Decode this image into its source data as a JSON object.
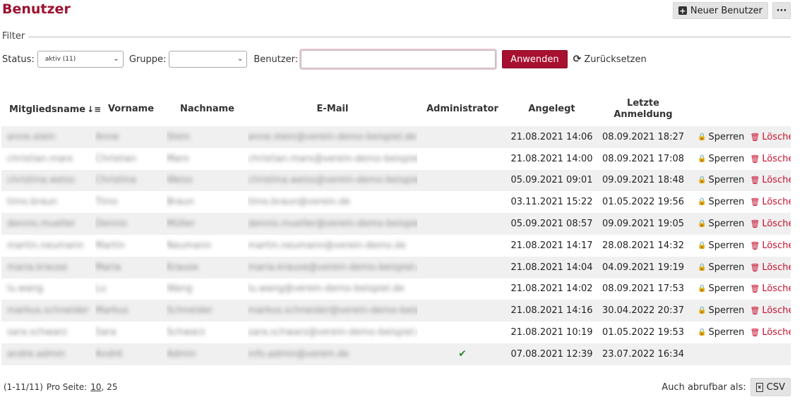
{
  "header": {
    "title": "Benutzer",
    "new_user_label": "Neuer Benutzer",
    "more_label": "···"
  },
  "filter": {
    "legend": "Filter",
    "status_label": "Status:",
    "status_value": "aktiv (11)",
    "group_label": "Gruppe:",
    "group_value": "",
    "user_label": "Benutzer:",
    "user_value": "",
    "apply_label": "Anwenden",
    "reset_label": "Zurücksetzen"
  },
  "table": {
    "columns": {
      "username": "Mitgliedsname",
      "firstname": "Vorname",
      "lastname": "Nachname",
      "email": "E-Mail",
      "admin": "Administrator",
      "created": "Angelegt",
      "last_login_1": "Letzte",
      "last_login_2": "Anmeldung"
    },
    "lock_label": "Sperren",
    "delete_label": "Löschen",
    "rows": [
      {
        "username": "anne.stein",
        "first": "Anne",
        "last": "Stein",
        "email": "anne.stein@verein-demo-beispiel.de",
        "admin": "",
        "created": "21.08.2021 14:06",
        "last_login": "08.09.2021 18:27"
      },
      {
        "username": "christian.marx",
        "first": "Christian",
        "last": "Marx",
        "email": "christian.marx@verein-demo-beispiel.de",
        "admin": "",
        "created": "21.08.2021 14:00",
        "last_login": "08.09.2021 17:08"
      },
      {
        "username": "christina.weiss",
        "first": "Christina",
        "last": "Weiss",
        "email": "christina.weiss@verein-demo-beispiel.de",
        "admin": "",
        "created": "05.09.2021 09:01",
        "last_login": "09.09.2021 18:48"
      },
      {
        "username": "timo.braun",
        "first": "Timo",
        "last": "Braun",
        "email": "timo.braun@verein.de",
        "admin": "",
        "created": "03.11.2021 15:22",
        "last_login": "01.05.2022 19:56"
      },
      {
        "username": "dennis.mueller",
        "first": "Dennis",
        "last": "Müller",
        "email": "dennis.mueller@verein-demo-beispiel.de",
        "admin": "",
        "created": "05.09.2021 08:57",
        "last_login": "09.09.2021 19:05"
      },
      {
        "username": "martin.neumann",
        "first": "Martin",
        "last": "Neumann",
        "email": "martin.neumann@verein-demo.de",
        "admin": "",
        "created": "21.08.2021 14:17",
        "last_login": "28.08.2021 14:32"
      },
      {
        "username": "maria.krause",
        "first": "Maria",
        "last": "Krause",
        "email": "maria.krause@verein-demo-beispiel.de",
        "admin": "",
        "created": "21.08.2021 14:04",
        "last_login": "04.09.2021 19:19"
      },
      {
        "username": "lu.wang",
        "first": "Lu",
        "last": "Wang",
        "email": "lu.wang@verein-demo-beispiel.de",
        "admin": "",
        "created": "21.08.2021 14:02",
        "last_login": "08.09.2021 17:53"
      },
      {
        "username": "markus.schneider",
        "first": "Markus",
        "last": "Schneider",
        "email": "markus.schneider@verein-demo-beispiel.de",
        "admin": "",
        "created": "21.08.2021 14:16",
        "last_login": "30.04.2022 20:37"
      },
      {
        "username": "sara.schwarz",
        "first": "Sara",
        "last": "Schwarz",
        "email": "sara.schwarz@verein-demo-beispiel.de",
        "admin": "",
        "created": "21.08.2021 10:19",
        "last_login": "01.05.2022 19:53"
      },
      {
        "username": "andre.admin",
        "first": "André",
        "last": "Admin",
        "email": "info.admin@verein.de",
        "admin": "✔",
        "created": "07.08.2021 12:39",
        "last_login": "23.07.2022 16:34"
      }
    ]
  },
  "footer": {
    "range": "(1-11/11)",
    "per_page_label": "Pro Seite:",
    "per_page_10": "10",
    "sep": ",",
    "per_page_25": "25",
    "also_label": "Auch abrufbar als:",
    "csv_label": "CSV"
  }
}
